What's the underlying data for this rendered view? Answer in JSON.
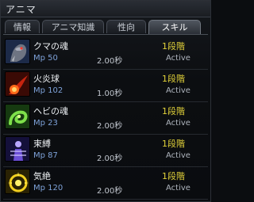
{
  "window": {
    "title": "アニマ"
  },
  "tabs": [
    {
      "label": "情報",
      "active": false
    },
    {
      "label": "アニマ知識",
      "active": false
    },
    {
      "label": "性向",
      "active": false
    },
    {
      "label": "スキル",
      "active": true
    }
  ],
  "skills": [
    {
      "icon": "bear-creature-icon",
      "name": "クマの魂",
      "mp": "Mp 50",
      "time": "2.00秒",
      "stage": "1段階",
      "status": "Active"
    },
    {
      "icon": "fireball-icon",
      "name": "火炎球",
      "mp": "Mp 102",
      "time": "1.00秒",
      "stage": "1段階",
      "status": "Active"
    },
    {
      "icon": "green-snake-icon",
      "name": "ヘビの魂",
      "mp": "Mp 23",
      "time": "2.00秒",
      "stage": "1段階",
      "status": "Active"
    },
    {
      "icon": "purple-figure-icon",
      "name": "束縛",
      "mp": "Mp 87",
      "time": "2.00秒",
      "stage": "1段階",
      "status": "Active"
    },
    {
      "icon": "yellow-burst-icon",
      "name": "気絶",
      "mp": "Mp 120",
      "time": "2.00秒",
      "stage": "1段階",
      "status": "Active"
    }
  ]
}
